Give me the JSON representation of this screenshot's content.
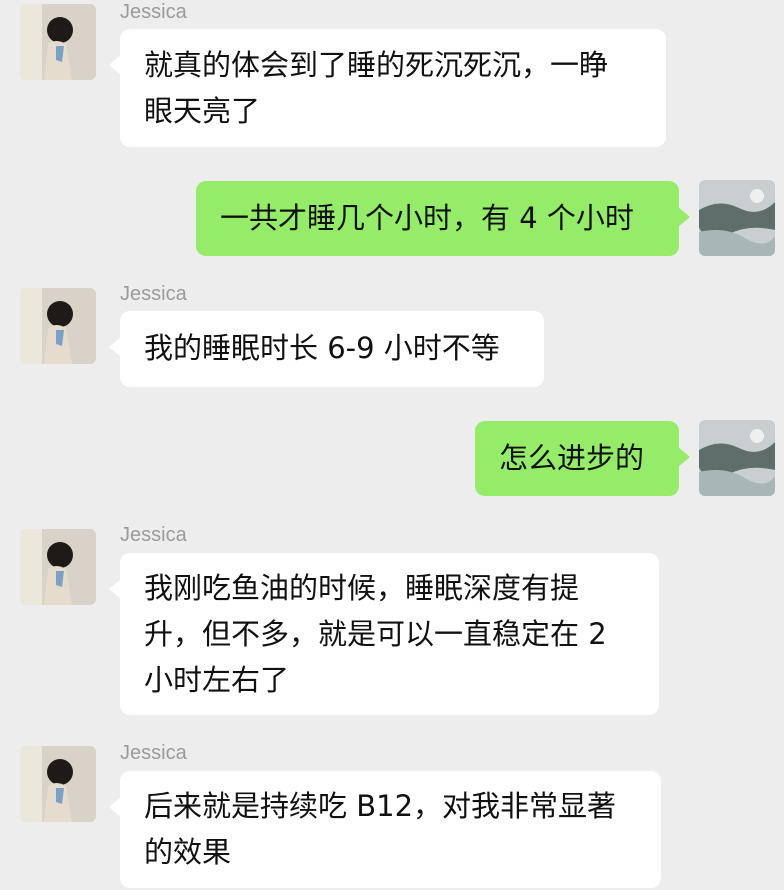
{
  "chat": {
    "messages": [
      {
        "sender": "Jessica",
        "lines": [
          "就真的体会到了睡的死沉死沉，一睁",
          "眼天亮了"
        ]
      },
      {
        "lines": [
          "一共才睡几个小时，有 4 个小时"
        ]
      },
      {
        "sender": "Jessica",
        "lines": [
          "我的睡眠时长 6-9 小时不等"
        ]
      },
      {
        "lines": [
          "怎么进步的"
        ]
      },
      {
        "sender": "Jessica",
        "lines": [
          "我刚吃鱼油的时候，睡眠深度有提",
          "升，但不多，就是可以一直稳定在 2",
          "小时左右了"
        ]
      },
      {
        "sender": "Jessica",
        "lines": [
          "后来就是持续吃 B12，对我非常显著",
          "的效果"
        ]
      }
    ]
  },
  "colors": {
    "background": "#ededed",
    "incoming_bubble": "#ffffff",
    "outgoing_bubble": "#95ec69"
  }
}
